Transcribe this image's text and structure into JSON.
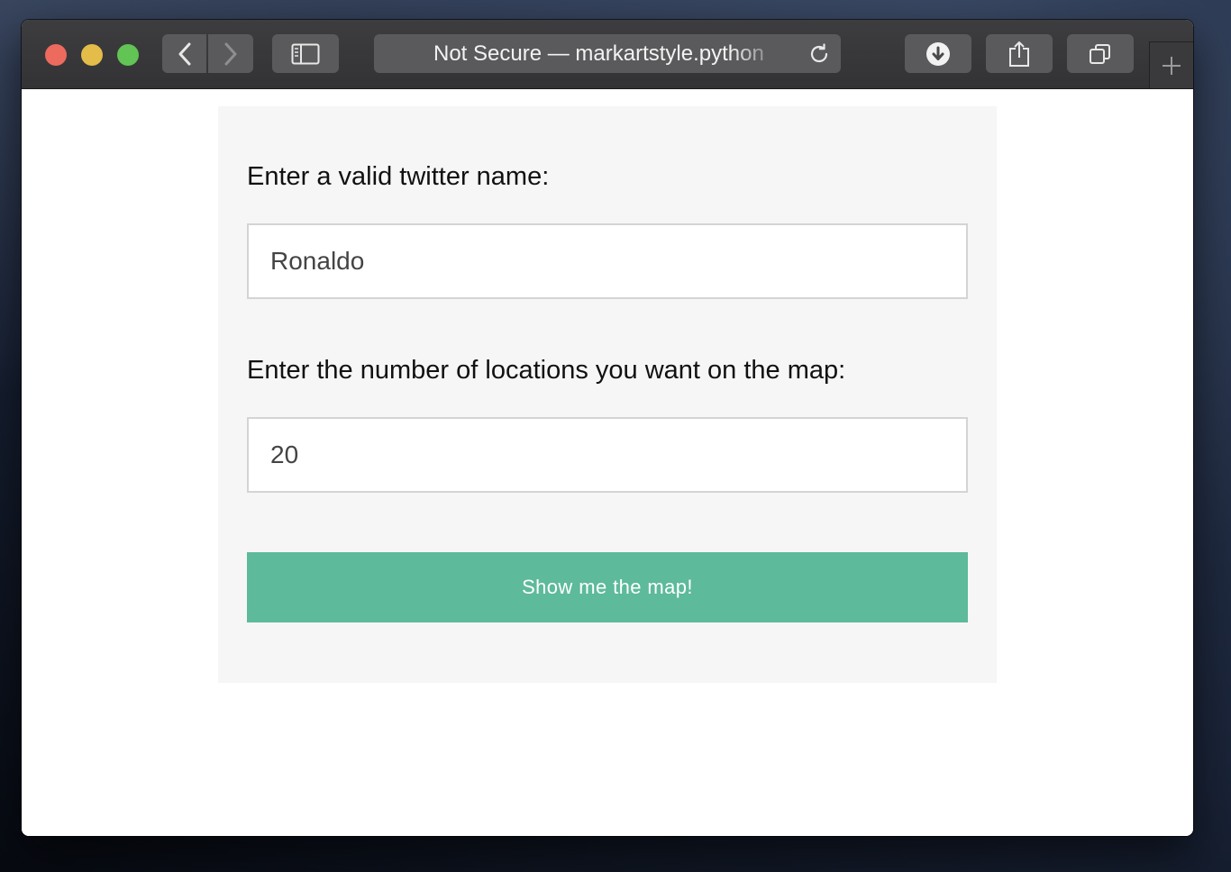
{
  "browser": {
    "address_text": "Not Secure — markartstyle.python",
    "icons": {
      "back": "chevron-left-icon",
      "forward": "chevron-right-icon",
      "sidebar": "sidebar-icon",
      "reload": "reload-icon",
      "download": "download-icon",
      "share": "share-icon",
      "tabs": "tabs-overview-icon",
      "new_tab": "plus-icon"
    }
  },
  "form": {
    "name_label": "Enter a valid twitter name:",
    "name_value": "Ronaldo",
    "count_label": "Enter the number of locations you want on the map:",
    "count_value": "20",
    "submit_label": "Show me the map!"
  },
  "colors": {
    "submit_button": "#5dba9b",
    "panel_background": "#f6f6f6",
    "close": "#ed6a5e",
    "minimize": "#e3bc4a",
    "maximize": "#61c454"
  }
}
